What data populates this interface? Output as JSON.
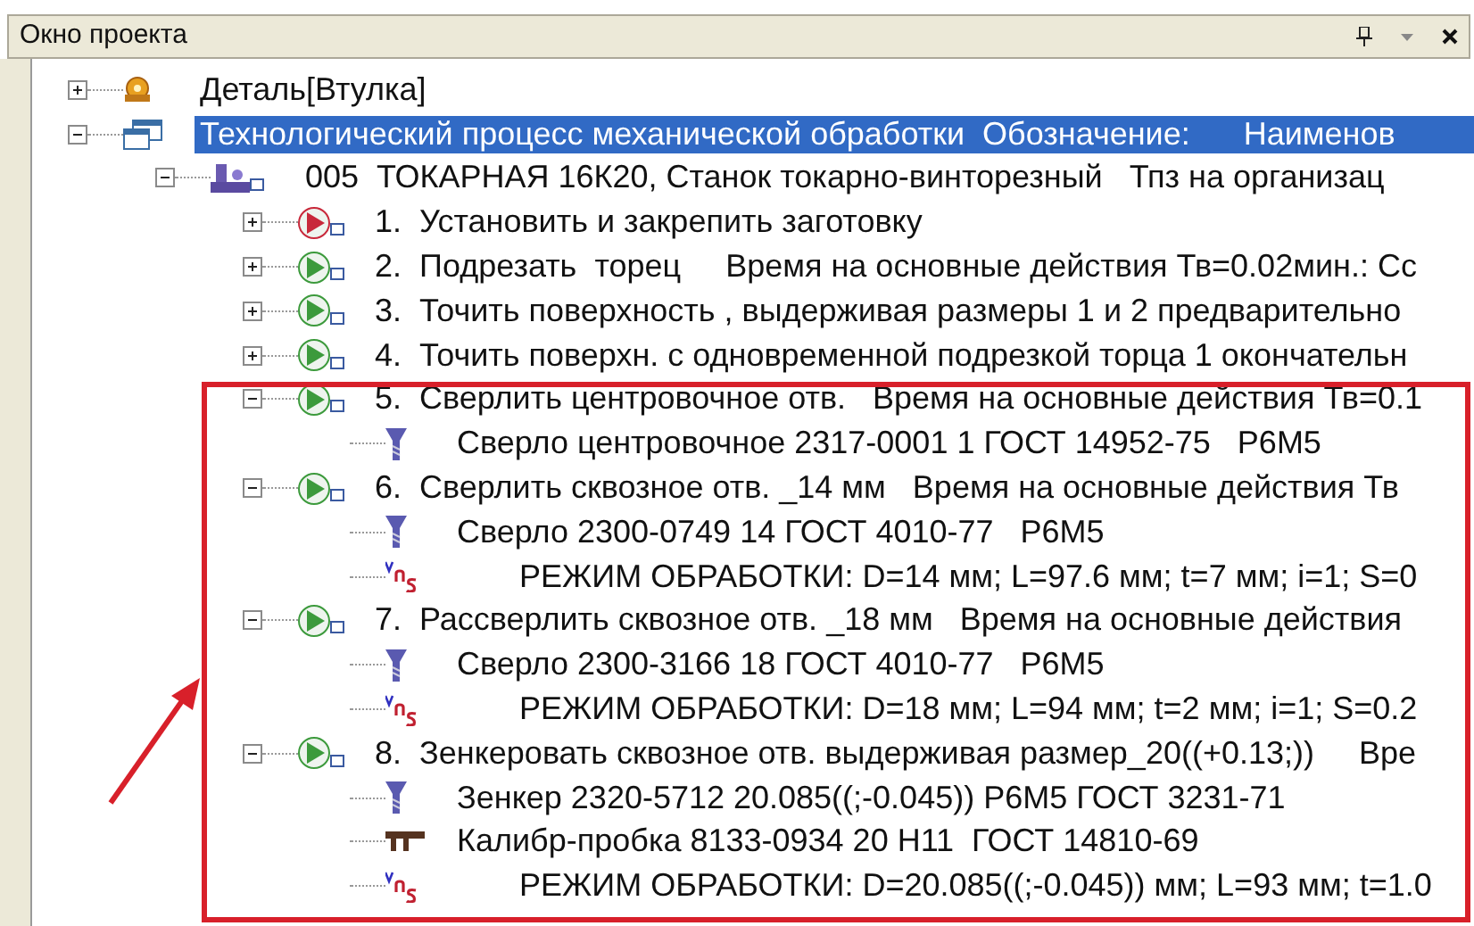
{
  "window": {
    "title": "Окно проекта"
  },
  "tree": [
    {
      "kind": "part",
      "label": "Деталь[Втулка]",
      "expanded": false,
      "selected": false
    },
    {
      "kind": "process",
      "label": "Технологический процесс механической обработки  Обозначение:      Наименов",
      "expanded": true,
      "selected": true,
      "children": [
        {
          "kind": "operation",
          "label": "005  ТОКАРНАЯ 16К20, Станок токарно-винторезный   Тпз на организац",
          "expanded": true,
          "selected": false,
          "children": [
            {
              "kind": "step",
              "color": "#c8283a",
              "label": "1.  Установить и закрепить заготовку",
              "expanded": false,
              "selected": false
            },
            {
              "kind": "step",
              "color": "#3c9a3c",
              "label": "2.  Подрезать  торец     Время на основные действия Тв=0.02мин.: Сс",
              "expanded": false,
              "selected": false
            },
            {
              "kind": "step",
              "color": "#3c9a3c",
              "label": "3.  Точить поверхность , выдерживая размеры 1 и 2 предварительно",
              "expanded": false,
              "selected": false
            },
            {
              "kind": "step",
              "color": "#3c9a3c",
              "label": "4.  Точить поверхн. с одновременной подрезкой торца 1 окончательн",
              "expanded": false,
              "selected": false
            },
            {
              "kind": "step",
              "color": "#3c9a3c",
              "label": "5.  Сверлить центровочное отв.   Время на основные действия Тв=0.1",
              "expanded": true,
              "selected": false,
              "children": [
                {
                  "kind": "tool",
                  "label": "Сверло центровочное 2317-0001 1 ГОСТ 14952-75   Р6М5",
                  "selected": false
                }
              ]
            },
            {
              "kind": "step",
              "color": "#3c9a3c",
              "label": "6.  Сверлить сквозное отв. _14 мм   Время на основные действия Тв",
              "expanded": true,
              "selected": false,
              "children": [
                {
                  "kind": "tool",
                  "label": "Сверло 2300-0749 14 ГОСТ 4010-77   Р6М5",
                  "selected": false
                },
                {
                  "kind": "mode",
                  "label": "РЕЖИМ ОБРАБОТКИ: D=14 мм; L=97.6 мм; t=7 мм; i=1; S=0",
                  "selected": false
                }
              ]
            },
            {
              "kind": "step",
              "color": "#3c9a3c",
              "label": "7.  Рассверлить сквозное отв. _18 мм   Время на основные действия",
              "expanded": true,
              "selected": false,
              "children": [
                {
                  "kind": "tool",
                  "label": "Сверло 2300-3166 18 ГОСТ 4010-77   Р6М5",
                  "selected": false
                },
                {
                  "kind": "mode",
                  "label": "РЕЖИМ ОБРАБОТКИ: D=18 мм; L=94 мм; t=2 мм; i=1; S=0.2",
                  "selected": false
                }
              ]
            },
            {
              "kind": "step",
              "color": "#3c9a3c",
              "label": "8.  Зенкеровать сквозное отв. выдерживая размер_20((+0.13;))     Вре",
              "expanded": true,
              "selected": false,
              "children": [
                {
                  "kind": "tool",
                  "label": "Зенкер 2320-5712 20.085((;-0.045)) Р6М5 ГОСТ 3231-71",
                  "selected": false
                },
                {
                  "kind": "gauge",
                  "label": "Калибр-пробка 8133-0934 20 Н11  ГОСТ 14810-69",
                  "selected": false
                },
                {
                  "kind": "mode",
                  "label": "РЕЖИМ ОБРАБОТКИ: D=20.085((;-0.045)) мм; L=93 мм; t=1.0",
                  "selected": false
                }
              ]
            }
          ]
        }
      ]
    }
  ]
}
